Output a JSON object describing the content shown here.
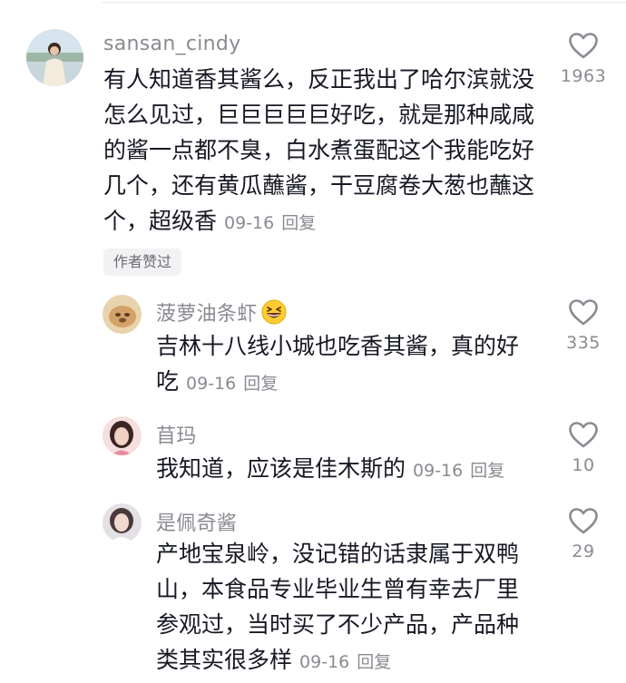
{
  "comments": [
    {
      "username": "sansan_cindy",
      "lines": [
        "有人知道香其酱么，反正我出了哈尔滨就没",
        "怎么见过，巨巨巨巨巨好吃，就是那种咸咸",
        "的酱一点都不臭，白水煮蛋配这个我能吃好",
        "几个，还有黄瓜蘸酱，干豆腐卷大葱也蘸这",
        "个，超级香"
      ],
      "date": "09-16",
      "reply_label": "回复",
      "like_count": "1963",
      "badge": "作者赞过"
    },
    {
      "username": "菠萝油条虾",
      "emoji": "grinning-squint-emoji",
      "lines": [
        "吉林十八线小城也吃香其酱，真的好",
        "吃"
      ],
      "date": "09-16",
      "reply_label": "回复",
      "like_count": "335"
    },
    {
      "username": "苜玛",
      "lines": [
        "我知道，应该是佳木斯的"
      ],
      "date": "09-16",
      "reply_label": "回复",
      "like_count": "10"
    },
    {
      "username": "是佩奇酱",
      "lines": [
        "产地宝泉岭，没记错的话隶属于双鸭",
        "山，本食品专业毕业生曾有幸去厂里",
        "参观过，当时买了不少产品，产品种",
        "类其实很多样"
      ],
      "date": "09-16",
      "reply_label": "回复",
      "like_count": "29"
    }
  ],
  "icons": {
    "like": "heart-outline-icon"
  },
  "colors": {
    "text": "#161823",
    "secondary": "#8a8b91",
    "badge_bg": "#f2f2f4"
  }
}
